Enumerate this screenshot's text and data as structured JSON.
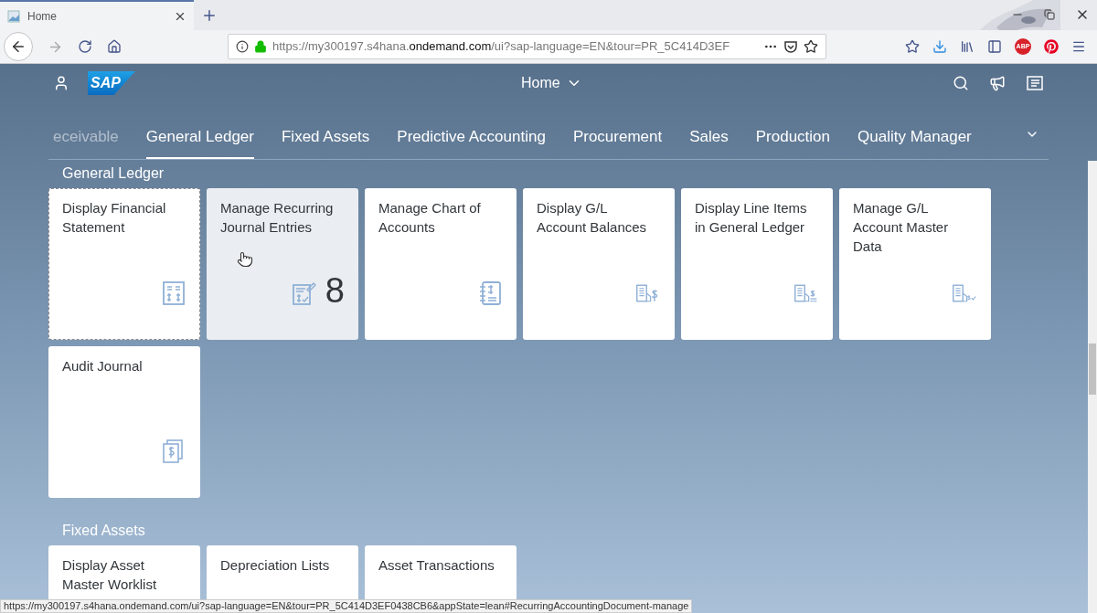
{
  "browser": {
    "tab": {
      "title": "Home"
    },
    "address": "https://my300197.s4hana.**ondemand.com**/ui?sap-language=EN&tour=PR_5C414D3EF",
    "adblock_badge": "ABP",
    "status_url": "https://my300197.s4hana.ondemand.com/ui?sap-language=EN&tour=PR_5C414D3EF0438CB6&appState=lean#RecurringAccountingDocument-manage"
  },
  "shell": {
    "logo": "SAP",
    "title": "Home"
  },
  "tabs": [
    {
      "label": "eceivable",
      "selected": false,
      "faded": true
    },
    {
      "label": "General Ledger",
      "selected": true,
      "faded": false
    },
    {
      "label": "Fixed Assets",
      "selected": false,
      "faded": false
    },
    {
      "label": "Predictive Accounting",
      "selected": false,
      "faded": false
    },
    {
      "label": "Procurement",
      "selected": false,
      "faded": false
    },
    {
      "label": "Sales",
      "selected": false,
      "faded": false
    },
    {
      "label": "Production",
      "selected": false,
      "faded": false
    },
    {
      "label": "Quality Manager",
      "selected": false,
      "faded": false
    }
  ],
  "sections": [
    {
      "title": "General Ledger",
      "tiles": [
        {
          "title": "Display Financial Statement",
          "focused": true,
          "hovered": false
        },
        {
          "title": "Manage Recurring Journal Entries",
          "count": "8",
          "focused": false,
          "hovered": true
        },
        {
          "title": "Manage Chart of Accounts",
          "focused": false,
          "hovered": false
        },
        {
          "title": "Display G/L Account Balances",
          "focused": false,
          "hovered": false
        },
        {
          "title": "Display Line Items in General Ledger",
          "focused": false,
          "hovered": false
        },
        {
          "title": "Manage G/L Account Master Data",
          "focused": false,
          "hovered": false
        },
        {
          "title": "Audit Journal",
          "focused": false,
          "hovered": false
        }
      ]
    },
    {
      "title": "Fixed Assets",
      "tiles": [
        {
          "title": "Display Asset Master Worklist",
          "focused": false,
          "hovered": false
        },
        {
          "title": "Depreciation Lists",
          "focused": false,
          "hovered": false
        },
        {
          "title": "Asset Transactions",
          "focused": false,
          "hovered": false
        }
      ]
    }
  ]
}
